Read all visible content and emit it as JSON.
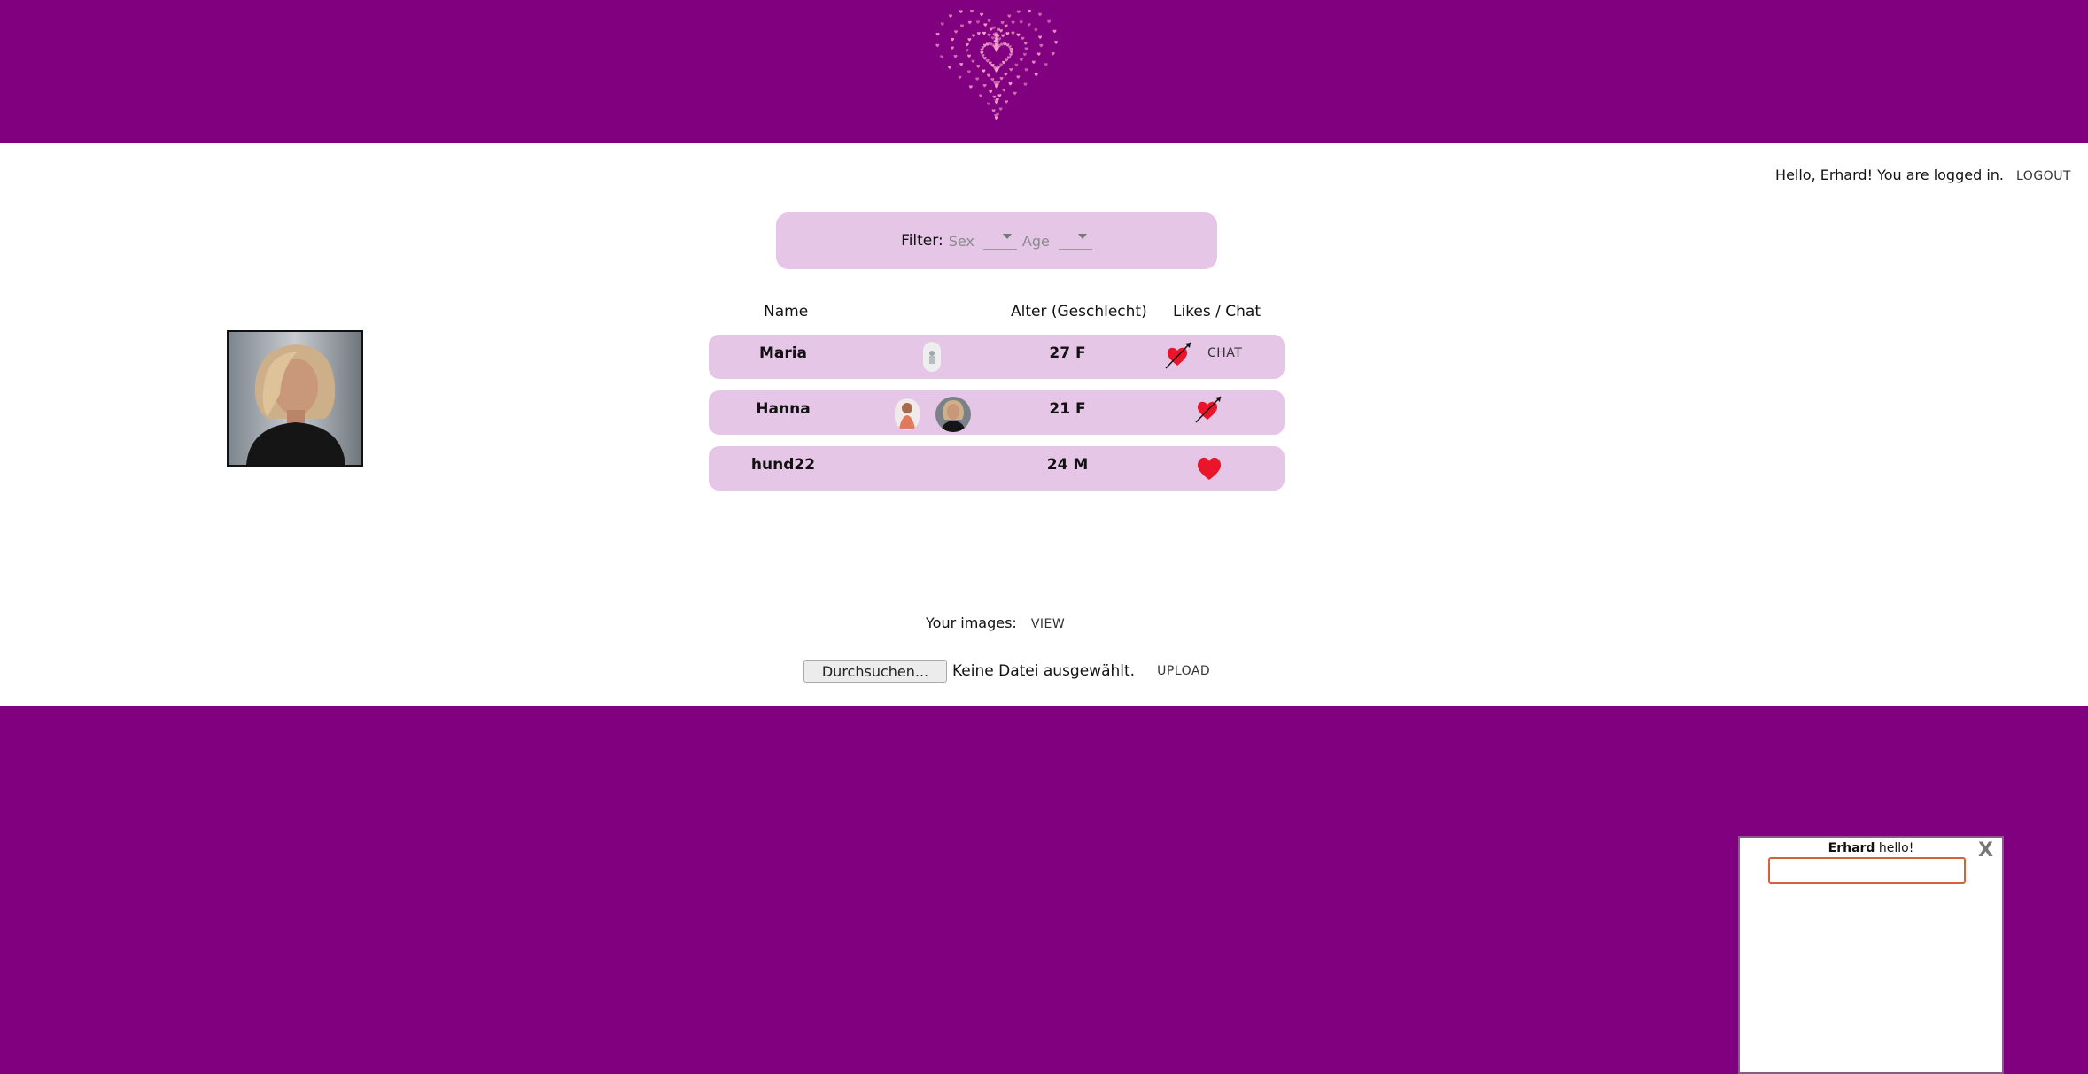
{
  "header": {
    "logo_icon": "heart-of-small-hearts-icon",
    "bg_color": "#800080"
  },
  "status": {
    "greeting": "Hello, Erhard! You are logged in.",
    "logout_label": "LOGOUT"
  },
  "filter": {
    "label": "Filter:",
    "sex_placeholder": "Sex",
    "age_placeholder": "Age"
  },
  "table": {
    "headers": {
      "name": "Name",
      "age": "Alter (Geschlecht)",
      "likes": "Likes / Chat"
    },
    "rows": [
      {
        "name": "Maria",
        "age": "27 F",
        "like": "heart-arrow-icon",
        "chat": "CHAT"
      },
      {
        "name": "Hanna",
        "age": "21 F",
        "like": "heart-arrow-icon"
      },
      {
        "name": "hund22",
        "age": "24 M",
        "like": "heart-icon"
      }
    ]
  },
  "images": {
    "label": "Your images:",
    "view_label": "VIEW"
  },
  "upload": {
    "browse_label": "Durchsuchen...",
    "no_file_label": "Keine Datei ausgewählt.",
    "upload_label": "UPLOAD"
  },
  "chat": {
    "close_label": "X",
    "sender": "Erhard",
    "message": "hello!",
    "input_value": ""
  },
  "colors": {
    "brand": "#800080",
    "row_bg": "#e6c6e6",
    "like_red": "#e8152b"
  }
}
